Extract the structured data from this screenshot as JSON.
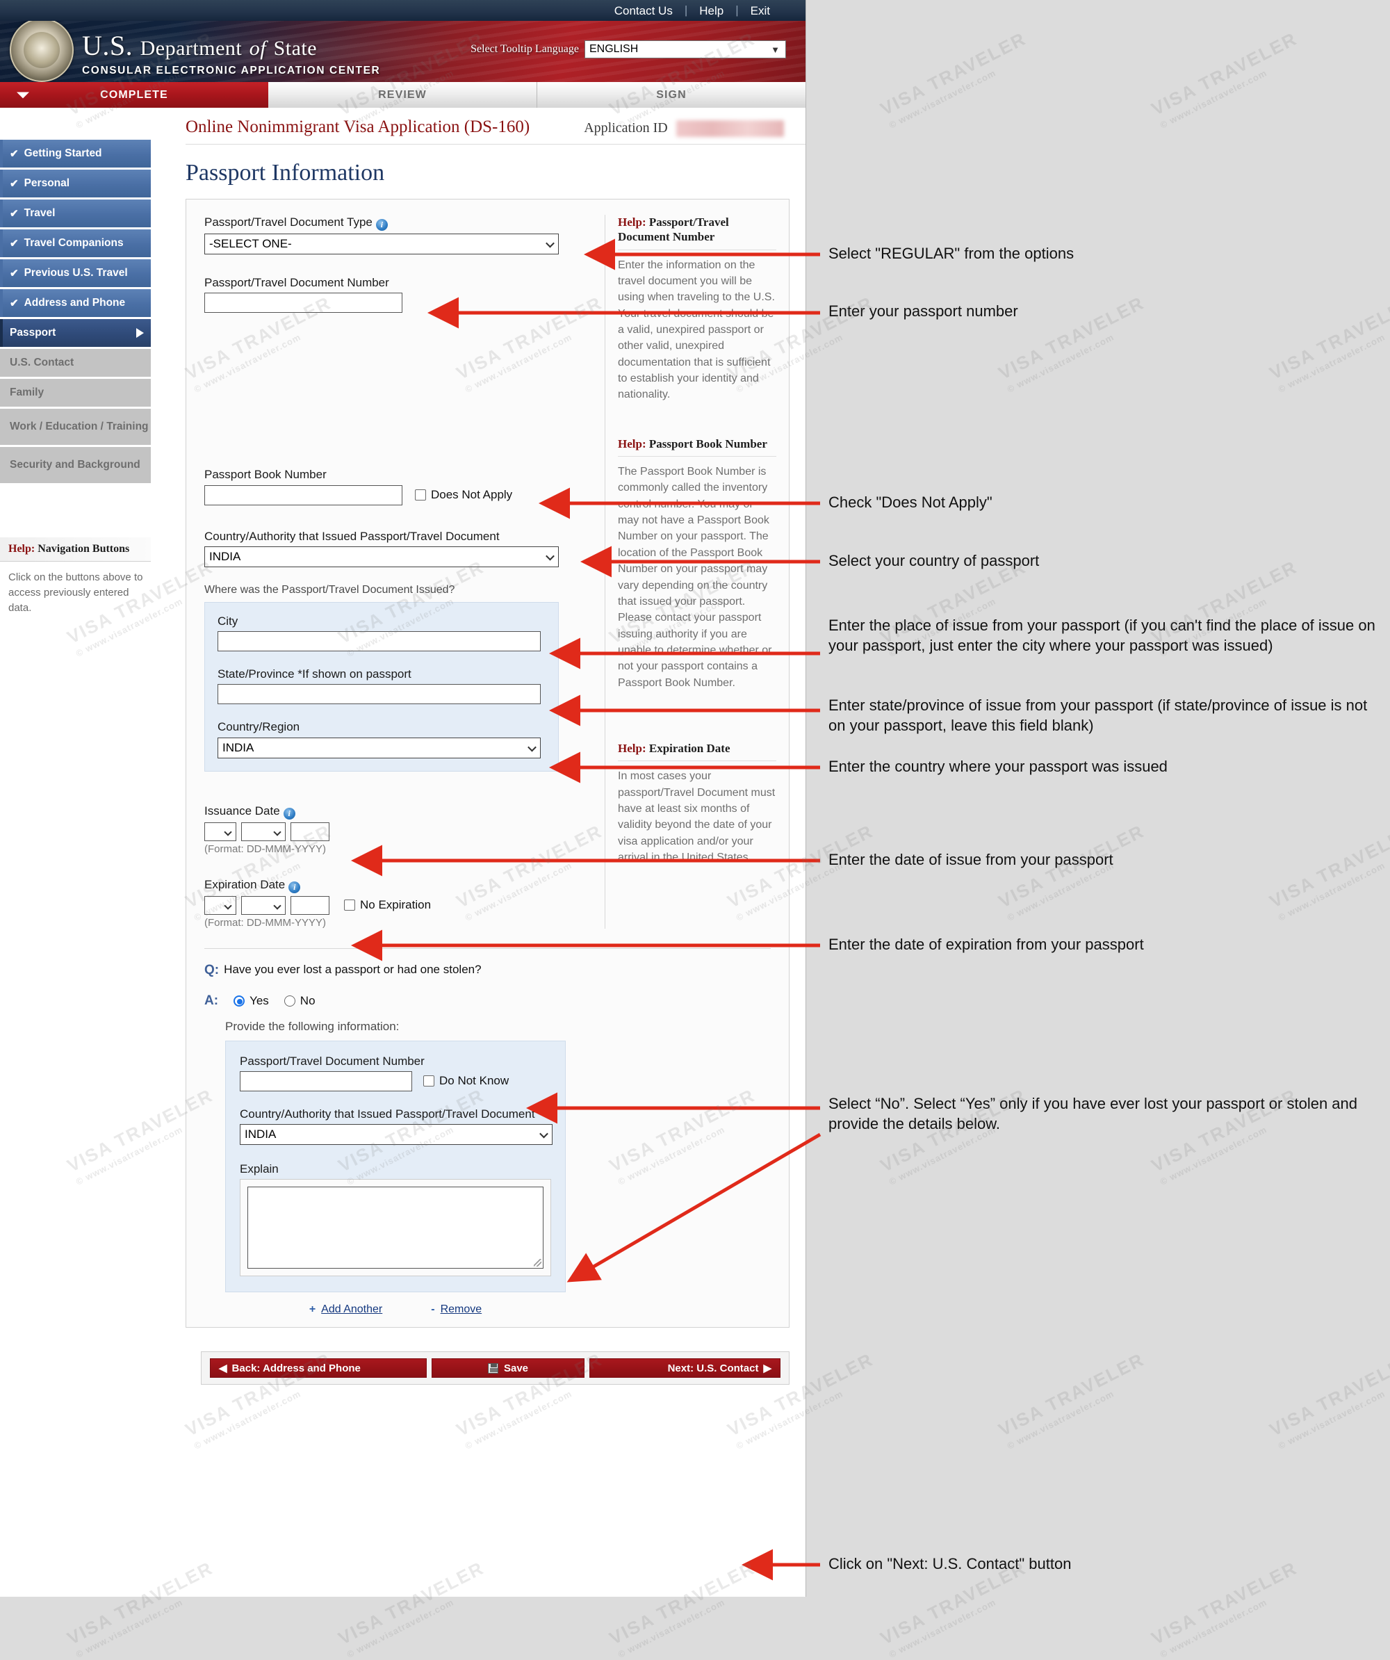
{
  "topbar": {
    "contact": "Contact Us",
    "help": "Help",
    "exit": "Exit"
  },
  "banner": {
    "title_us": "U.S.",
    "title_dept": "Department",
    "title_of": "of",
    "title_state": "State",
    "subtitle": "CONSULAR ELECTRONIC APPLICATION CENTER",
    "lang_label": "Select Tooltip Language",
    "lang_value": "ENGLISH"
  },
  "tabs": [
    {
      "label": "COMPLETE",
      "active": true
    },
    {
      "label": "REVIEW",
      "active": false
    },
    {
      "label": "SIGN",
      "active": false
    }
  ],
  "sidebar": {
    "items": [
      {
        "label": "Getting Started",
        "state": "done"
      },
      {
        "label": "Personal",
        "state": "done"
      },
      {
        "label": "Travel",
        "state": "done"
      },
      {
        "label": "Travel Companions",
        "state": "done"
      },
      {
        "label": "Previous U.S. Travel",
        "state": "done"
      },
      {
        "label": "Address and Phone",
        "state": "done"
      },
      {
        "label": "Passport",
        "state": "current"
      },
      {
        "label": "U.S. Contact",
        "state": "todo"
      },
      {
        "label": "Family",
        "state": "todo"
      },
      {
        "label": "Work / Education / Training",
        "state": "todo"
      },
      {
        "label": "Security and Background",
        "state": "todo"
      }
    ],
    "help_title_word": "Help:",
    "help_title_rest": " Navigation Buttons",
    "help_body": "Click on the buttons above to access previously entered data."
  },
  "header": {
    "app_title": "Online Nonimmigrant Visa Application (DS-160)",
    "appid_label": "Application ID",
    "page_title": "Passport Information"
  },
  "form": {
    "doc_type_label": "Passport/Travel Document Type",
    "doc_type_value": "-SELECT ONE-",
    "doc_number_label": "Passport/Travel Document Number",
    "doc_number_value": "",
    "book_number_label": "Passport Book Number",
    "book_number_value": "",
    "does_not_apply_label": "Does Not Apply",
    "issuing_country_label": "Country/Authority that Issued Passport/Travel Document",
    "issuing_country_value": "INDIA",
    "where_issued_label": "Where was the Passport/Travel Document Issued?",
    "city_label": "City",
    "city_value": "",
    "state_label": "State/Province *If shown on passport",
    "state_value": "",
    "country_region_label": "Country/Region",
    "country_region_value": "INDIA",
    "issuance_date_label": "Issuance Date",
    "issuance_day": "",
    "issuance_month": "",
    "issuance_year": "",
    "date_format_note": "(Format: DD-MMM-YYYY)",
    "expiration_date_label": "Expiration Date",
    "expiration_day": "",
    "expiration_month": "",
    "expiration_year": "",
    "no_expiration_label": "No Expiration"
  },
  "help_panels": {
    "doc_number": {
      "title_word": "Help:",
      "title_rest": " Passport/Travel Document Number",
      "body": "Enter the information on the travel document you will be using when traveling to the U.S. Your travel document should be a valid, unexpired passport or other valid, unexpired documentation that is sufficient to establish your identity and nationality."
    },
    "book_number": {
      "title_word": "Help:",
      "title_rest": " Passport Book Number",
      "body": "The Passport Book Number is commonly called the inventory control number. You may or may not have a Passport Book Number on your passport. The location of the Passport Book Number on your passport may vary depending on the country that issued your passport. Please contact your passport issuing authority if you are unable to determine whether or not your passport contains a Passport Book Number."
    },
    "expiration_date": {
      "title_word": "Help:",
      "title_rest": " Expiration Date",
      "body": "In most cases your passport/Travel Document must have at least six months of validity beyond the date of your visa application and/or your arrival in the United States."
    }
  },
  "qa": {
    "q_mark": "Q:",
    "a_mark": "A:",
    "question": "Have you ever lost a passport or had one stolen?",
    "yes_label": "Yes",
    "no_label": "No",
    "selected": "Yes",
    "provide_label": "Provide the following information:",
    "lost_doc_number_label": "Passport/Travel Document Number",
    "lost_doc_number_value": "",
    "do_not_know_label": "Do Not Know",
    "lost_country_label": "Country/Authority that Issued Passport/Travel Document",
    "lost_country_value": "INDIA",
    "explain_label": "Explain",
    "explain_value": "",
    "add_another_label": "Add Another",
    "remove_label": "Remove",
    "add_icon": "+",
    "remove_icon": "-"
  },
  "buttons": {
    "back_label": "Back: Address and Phone",
    "save_label": "Save",
    "next_label": "Next: U.S. Contact"
  },
  "annotations": [
    {
      "id": "a1",
      "text": "Select \"REGULAR\" from the options"
    },
    {
      "id": "a2",
      "text": "Enter your passport number"
    },
    {
      "id": "a3",
      "text": "Check \"Does Not Apply\""
    },
    {
      "id": "a4",
      "text": "Select your country of passport"
    },
    {
      "id": "a5",
      "text": "Enter the place of issue from your passport (if you can't find the place of issue on your passport, just enter the city where your passport was issued)"
    },
    {
      "id": "a6",
      "text": "Enter state/province of issue from your passport (if state/province of issue is not on your passport, leave this field blank)"
    },
    {
      "id": "a7",
      "text": "Enter the country where your passport was issued"
    },
    {
      "id": "a8",
      "text": "Enter the date of issue from your passport"
    },
    {
      "id": "a9",
      "text": "Enter the date of expiration from your passport"
    },
    {
      "id": "a10",
      "text": "Select “No”. Select “Yes” only if you have ever lost your passport or stolen and provide the details below."
    },
    {
      "id": "a11",
      "text": "Click on \"Next: U.S. Contact\" button"
    }
  ],
  "watermark": {
    "line1": "VISA TRAVELER",
    "line2": "© www.visatraveler.com"
  },
  "colors": {
    "accent_red": "#a8181e",
    "nav_done_blue": "#4a6fa5",
    "nav_current_blue": "#2f4a79",
    "arrow_red": "#e02a1a",
    "page_title_blue": "#1f3864",
    "help_red": "#8a1212"
  }
}
